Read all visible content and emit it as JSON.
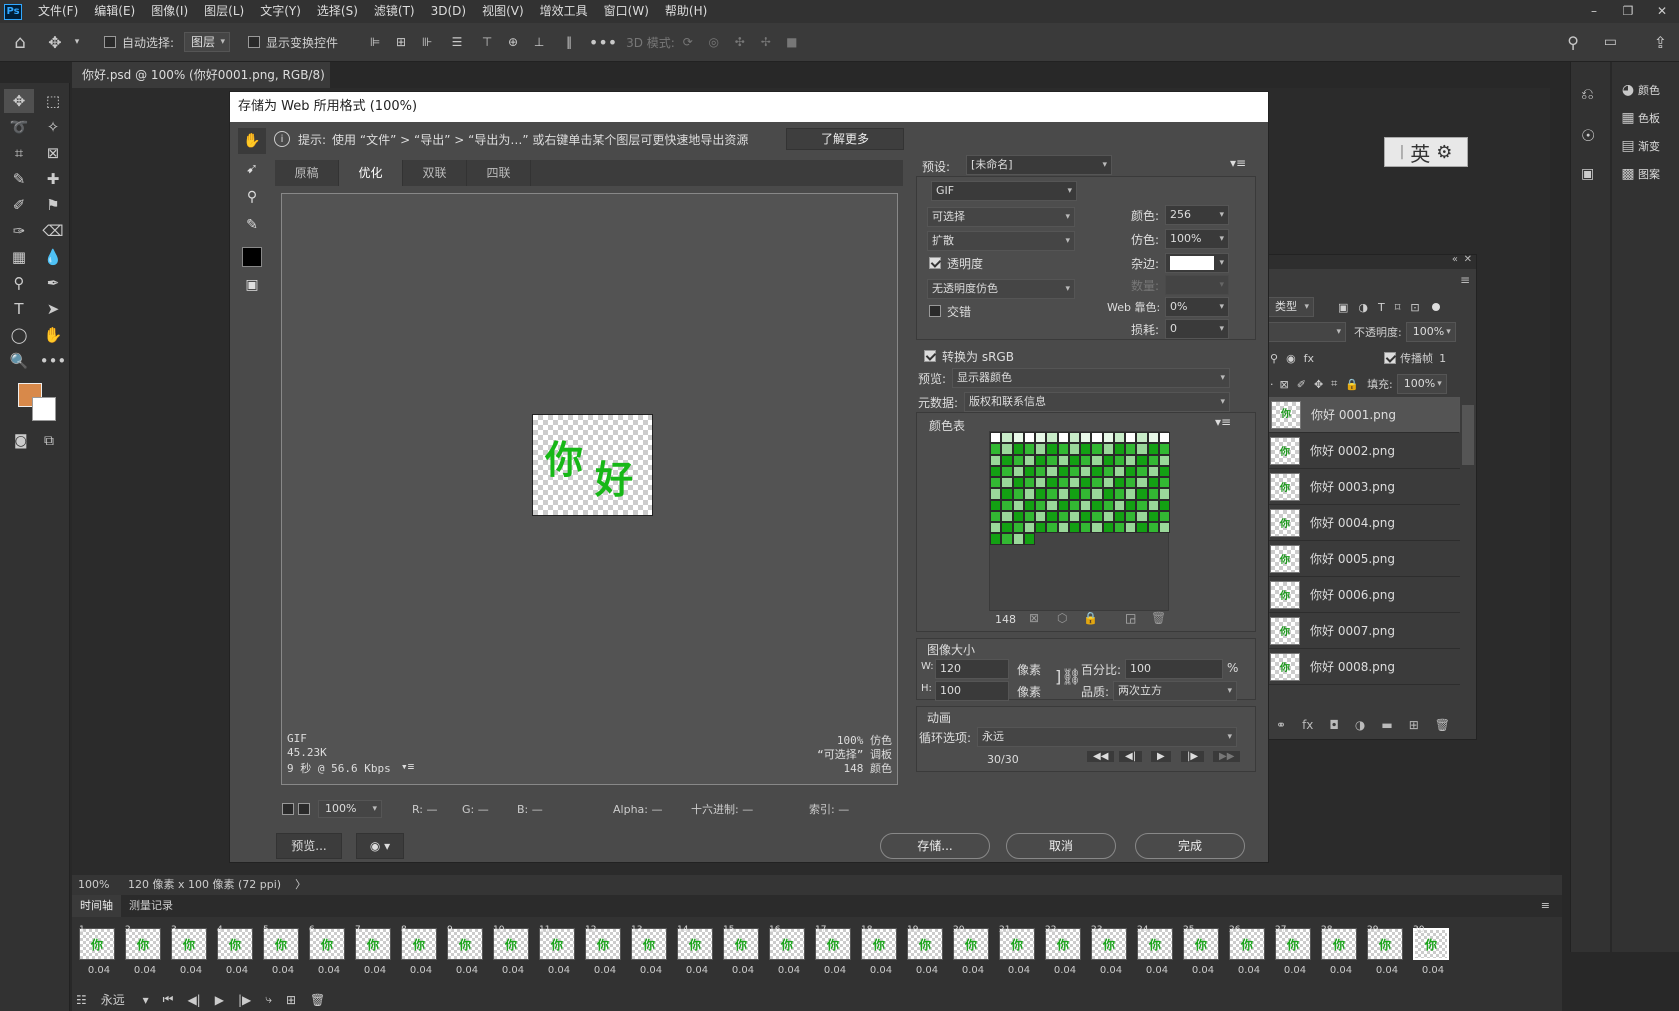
{
  "menubar": {
    "logo": "Ps",
    "items": [
      "文件(F)",
      "编辑(E)",
      "图像(I)",
      "图层(L)",
      "文字(Y)",
      "选择(S)",
      "滤镜(T)",
      "3D(D)",
      "视图(V)",
      "增效工具",
      "窗口(W)",
      "帮助(H)"
    ]
  },
  "optbar": {
    "auto_select_label": "自动选择:",
    "auto_select_value": "图层",
    "show_transform_label": "显示变换控件",
    "mode3d_label": "3D 模式:"
  },
  "document": {
    "tab_title": "你好.psd @ 100% (你好0001.png, RGB/8)",
    "close": "×"
  },
  "status": {
    "zoom": "100%",
    "dimensions": "120 像素 x 100 像素 (72 ppi)",
    "more": "〉"
  },
  "right_panel": {
    "items": [
      {
        "icon": "palette-icon",
        "label": "颜色"
      },
      {
        "icon": "swatches-icon",
        "label": "色板"
      },
      {
        "icon": "gradient-icon",
        "label": "渐变"
      },
      {
        "icon": "patterns-icon",
        "label": "图案"
      }
    ]
  },
  "ime": {
    "text": "英"
  },
  "layers": {
    "kind_label": "类型",
    "opacity_label": "不透明度:",
    "opacity_value": "100%",
    "propagate_label": "传播帧",
    "propagate_value": "1",
    "fill_label": "填充:",
    "fill_value": "100%",
    "items": [
      "你好 0001.png",
      "你好 0002.png",
      "你好 0003.png",
      "你好 0004.png",
      "你好 0005.png",
      "你好 0006.png",
      "你好 0007.png",
      "你好 0008.png"
    ]
  },
  "timeline": {
    "tabs": [
      "时间轴",
      "测量记录"
    ],
    "frame_delay": "0.04",
    "frame_count": 30,
    "current_frame": 30,
    "loop_value": "永远"
  },
  "dialog": {
    "title": "存储为 Web 所用格式 (100%)",
    "tip_label": "提示:",
    "tip_text": "使用 “文件” > “导出” > “导出为…” 或右键单击某个图层可更快速地导出资源",
    "learn_more": "了解更多",
    "tabs": [
      "原稿",
      "优化",
      "双联",
      "四联"
    ],
    "active_tab": "优化",
    "preview_chars": [
      "你",
      "好"
    ],
    "info_left": [
      "GIF",
      "45.23K",
      "9 秒 @ 56.6 Kbps"
    ],
    "info_right": [
      "100% 仿色",
      "“可选择” 调板",
      "148 颜色"
    ],
    "bottom": {
      "zoom": "100%",
      "r": "R: —",
      "g": "G: —",
      "b": "B: —",
      "alpha": "Alpha: —",
      "hex": "十六进制: —",
      "index": "索引: —"
    },
    "preview_btn": "预览...",
    "save_btn": "存储...",
    "cancel_btn": "取消",
    "done_btn": "完成",
    "settings": {
      "preset_label": "预设:",
      "preset_value": "[未命名]",
      "format": "GIF",
      "reduction": "可选择",
      "dither_algo": "扩散",
      "transparency_label": "透明度",
      "transparency_dither": "无透明度仿色",
      "interlaced_label": "交错",
      "colors_label": "颜色:",
      "colors_value": "256",
      "dither_label": "仿色:",
      "dither_value": "100%",
      "matte_label": "杂边:",
      "amount_label": "数量:",
      "websnap_label": "Web 靠色:",
      "websnap_value": "0%",
      "lossy_label": "损耗:",
      "lossy_value": "0",
      "convert_srgb_label": "转换为 sRGB",
      "preview_label": "预览:",
      "preview_value": "显示器颜色",
      "metadata_label": "元数据:",
      "metadata_value": "版权和联系信息",
      "color_table_label": "颜色表",
      "color_count": "148",
      "image_size_label": "图像大小",
      "w_label": "W:",
      "w_value": "120",
      "h_label": "H:",
      "h_value": "100",
      "px_label": "像素",
      "percent_label": "百分比:",
      "percent_value": "100",
      "pct_unit": "%",
      "quality_label": "品质:",
      "quality_value": "两次立方",
      "animation_label": "动画",
      "loop_label": "循环选项:",
      "loop_value": "永远",
      "frame_counter": "30/30"
    }
  },
  "colors": {
    "foreground": "#d8894a",
    "background": "#ffffff",
    "green_dark": "#13a013",
    "green_mid": "#33b833",
    "green_light": "#9ad89a"
  }
}
